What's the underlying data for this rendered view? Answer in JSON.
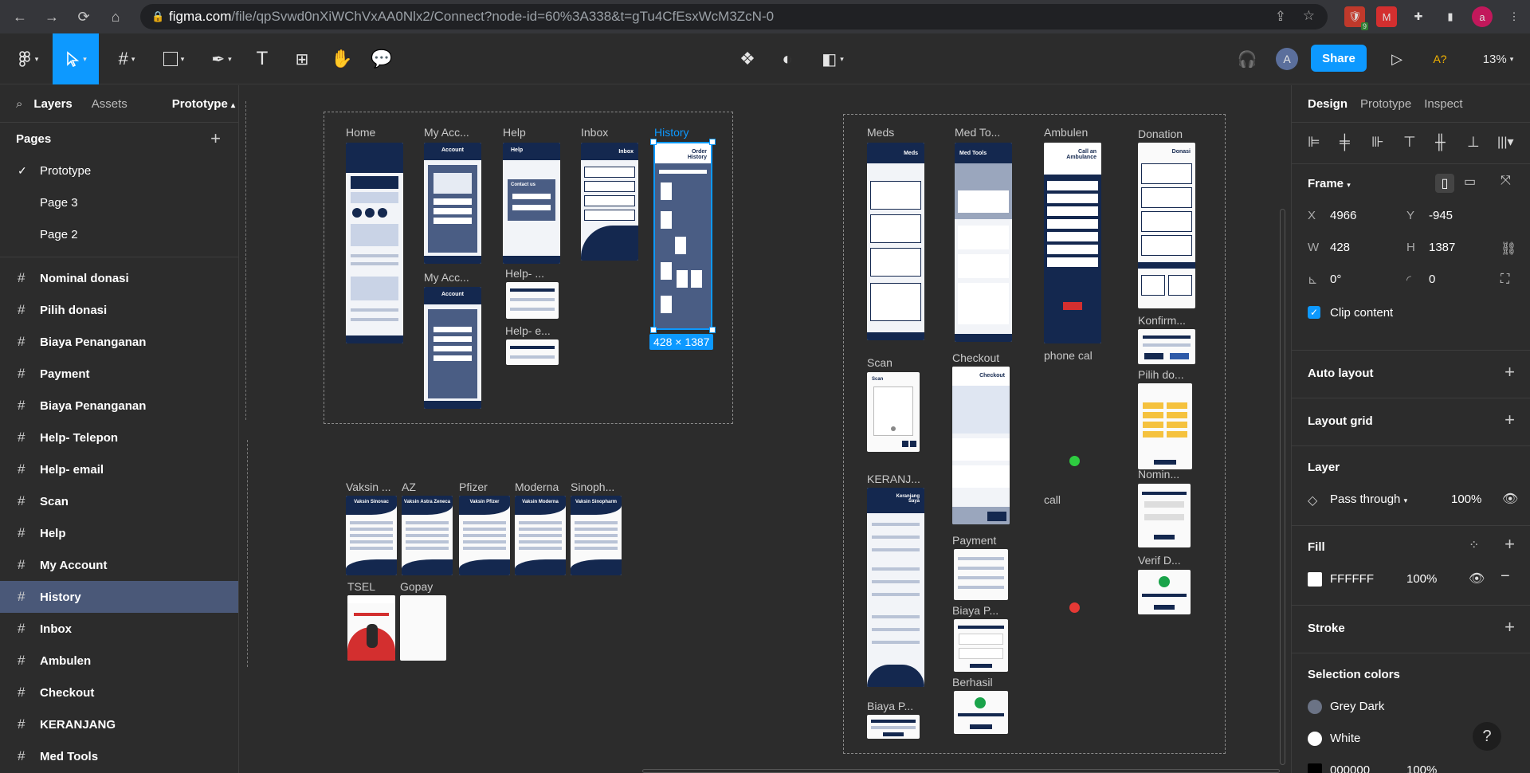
{
  "browser": {
    "url_host": "figma.com",
    "url_path": "/file/qpSvwd0nXiWChVxAA0Nlx2/Connect?node-id=60%3A338&t=gTu4CfEsxWcM3ZcN-0",
    "ext_badge": "9",
    "profile_initial": "a"
  },
  "toolbar": {
    "share_label": "Share",
    "zoom": "13%",
    "avatar_initial": "A",
    "text_tool": "T",
    "ai_label": "A?"
  },
  "left_panel": {
    "tabs": [
      "Layers",
      "Assets"
    ],
    "prototype_tab": "Prototype",
    "pages_title": "Pages",
    "pages": [
      "Prototype",
      "Page 3",
      "Page 2"
    ],
    "layers": [
      "Nominal donasi",
      "Pilih donasi",
      "Biaya Penanganan",
      "Payment",
      "Biaya Penanganan",
      "Help- Telepon",
      "Help- email",
      "Scan",
      "Help",
      "My Account",
      "History",
      "Inbox",
      "Ambulen",
      "Checkout",
      "KERANJANG",
      "Med Tools"
    ]
  },
  "canvas": {
    "group1": [
      "Home",
      "My Acc...",
      "Help",
      "Inbox",
      "History"
    ],
    "my_acc2": "My Acc...",
    "help_tel": "Help- ...",
    "help_email": "Help- e...",
    "selection_dim": "428 × 1387",
    "group2": [
      "Vaksin ...",
      "AZ",
      "Pfizer",
      "Moderna",
      "Sinoph..."
    ],
    "group3": [
      "TSEL",
      "Gopay"
    ],
    "right": {
      "meds": "Meds",
      "medtools": "Med To...",
      "ambulen": "Ambulen",
      "donation": "Donation",
      "scan": "Scan",
      "checkout": "Checkout",
      "phone": "phone cal",
      "konfirm": "Konfirm...",
      "pilih": "Pilih do...",
      "keranjang": "KERANJ...",
      "call": "call",
      "nomin": "Nomin...",
      "payment": "Payment",
      "biaya1": "Biaya P...",
      "verif": "Verif D...",
      "berhasil": "Berhasil",
      "biaya2": "Biaya P..."
    },
    "frame_titles": {
      "account": "Account",
      "help": "Help",
      "inbox": "Inbox",
      "history": "Order History",
      "contact": "Contact us",
      "meds": "Meds",
      "medtools": "Med Tools",
      "ambulance": "Call an Ambulance",
      "donasi": "Donasi",
      "checkout": "Checkout",
      "keranjang": "Keranjang Saya",
      "scan": "Scan",
      "v_sinovac": "Vaksin Sinovac",
      "v_az": "Vaksin Astra Zeneca",
      "v_pfizer": "Vaksin Pfizer",
      "v_moderna": "Vaksin Moderna",
      "v_sinopharm": "Vaksin Sinopharm"
    }
  },
  "right_panel": {
    "tabs": [
      "Design",
      "Prototype",
      "Inspect"
    ],
    "frame_label": "Frame",
    "x_label": "X",
    "x": "4966",
    "y_label": "Y",
    "y": "-945",
    "w_label": "W",
    "w": "428",
    "h_label": "H",
    "h": "1387",
    "rotation": "0°",
    "radius": "0",
    "clip_content": "Clip content",
    "auto_layout": "Auto layout",
    "layout_grid": "Layout grid",
    "layer_title": "Layer",
    "blend": "Pass through",
    "layer_opacity": "100%",
    "fill_title": "Fill",
    "fill_hex": "FFFFFF",
    "fill_opacity": "100%",
    "stroke_title": "Stroke",
    "selection_colors_title": "Selection colors",
    "colors": [
      {
        "name": "Grey Dark",
        "hex": "#6b7385"
      },
      {
        "name": "White",
        "hex": "#ffffff"
      },
      {
        "name": "000000",
        "hex": "#000000",
        "opacity": "100%"
      }
    ]
  },
  "colors": {
    "accent": "#0d99ff",
    "navy": "#14284f",
    "selected_layer": "#4a5878"
  }
}
